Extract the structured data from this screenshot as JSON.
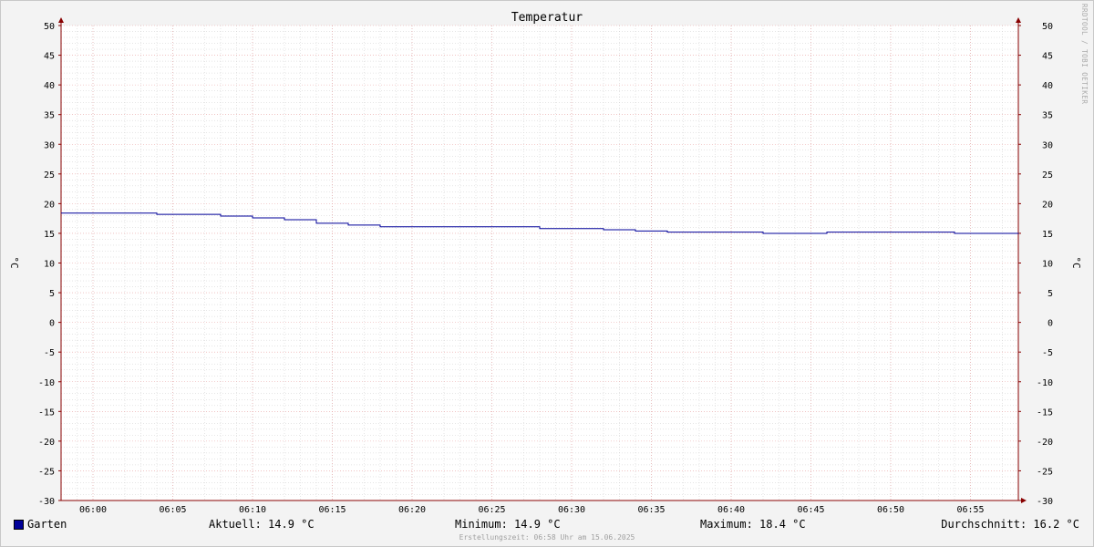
{
  "chart_data": {
    "type": "line",
    "title": "Temperatur",
    "ylabel": "°C",
    "ylabel_right": "°C",
    "ylim": [
      -30,
      50
    ],
    "y_ticks": [
      "50",
      "45",
      "40",
      "35",
      "30",
      "25",
      "20",
      "15",
      "10",
      "5",
      "0",
      "-5",
      "-10",
      "-15",
      "-20",
      "-25",
      "-30"
    ],
    "x_ticks": [
      "06:00",
      "06:05",
      "06:10",
      "06:15",
      "06:20",
      "06:25",
      "06:30",
      "06:35",
      "06:40",
      "06:45",
      "06:50",
      "06:55"
    ],
    "xlim": [
      "05:58",
      "05:58+60min"
    ],
    "grid": true,
    "series": [
      {
        "name": "Garten",
        "color": "#000099",
        "x_minutes_from_0558": [
          0,
          6,
          10,
          12,
          14,
          16,
          18,
          20,
          30,
          34,
          36,
          38,
          44,
          48,
          56,
          60
        ],
        "values": [
          18.4,
          18.2,
          17.9,
          17.6,
          17.3,
          16.7,
          16.4,
          16.1,
          15.8,
          15.6,
          15.4,
          15.2,
          15.0,
          15.2,
          15.0,
          14.9
        ]
      }
    ]
  },
  "legend": {
    "series_name": "Garten",
    "current": "Aktuell: 14.9 °C",
    "minimum": "Minimum: 14.9 °C",
    "maximum": "Maximum: 18.4 °C",
    "average": "Durchschnitt: 16.2 °C"
  },
  "footer": "Erstellungszeit: 06:58 Uhr am 15.06.2025",
  "watermark": "RRDTOOL / TOBI OETIKER",
  "colors": {
    "line": "#000099",
    "major_grid": "#e8a0a0",
    "minor_grid": "#cccccc",
    "axis": "#880000"
  }
}
